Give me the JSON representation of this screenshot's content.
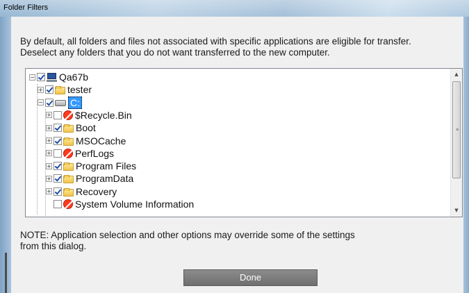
{
  "window": {
    "title": "Folder Filters"
  },
  "intro": {
    "line1": "By default, all folders and files not associated with specific applications are eligible for transfer.",
    "line2": "Deselect any folders that you do not want transferred to the new computer."
  },
  "tree": {
    "items": [
      {
        "label": "Qa67b",
        "expander": "-",
        "checked": true,
        "icon": "computer-icon",
        "depth": 0
      },
      {
        "label": "tester",
        "expander": "+",
        "checked": true,
        "icon": "folder-icon",
        "depth": 1
      },
      {
        "label": "C:",
        "expander": "-",
        "checked": true,
        "icon": "drive-icon",
        "depth": 1,
        "selected": true
      },
      {
        "label": "$Recycle.Bin",
        "expander": "+",
        "checked": false,
        "icon": "blocked-folder-icon",
        "depth": 2
      },
      {
        "label": "Boot",
        "expander": "+",
        "checked": true,
        "icon": "folder-icon",
        "depth": 2
      },
      {
        "label": "MSOCache",
        "expander": "+",
        "checked": true,
        "icon": "folder-icon",
        "depth": 2
      },
      {
        "label": "PerfLogs",
        "expander": "+",
        "checked": false,
        "icon": "blocked-folder-icon",
        "depth": 2
      },
      {
        "label": "Program Files",
        "expander": "+",
        "checked": true,
        "icon": "folder-icon",
        "depth": 2
      },
      {
        "label": "ProgramData",
        "expander": "+",
        "checked": true,
        "icon": "folder-icon",
        "depth": 2
      },
      {
        "label": "Recovery",
        "expander": "+",
        "checked": true,
        "icon": "folder-icon",
        "depth": 2
      },
      {
        "label": "System Volume Information",
        "expander": "",
        "checked": false,
        "icon": "blocked-folder-icon",
        "depth": 2
      }
    ]
  },
  "note": {
    "line1": "NOTE:  Application selection and other options may override some of the settings",
    "line2": "from this dialog."
  },
  "buttons": {
    "done_label": "Done"
  },
  "colors": {
    "selection": "#3399ff",
    "button": "#7a7a7a"
  }
}
